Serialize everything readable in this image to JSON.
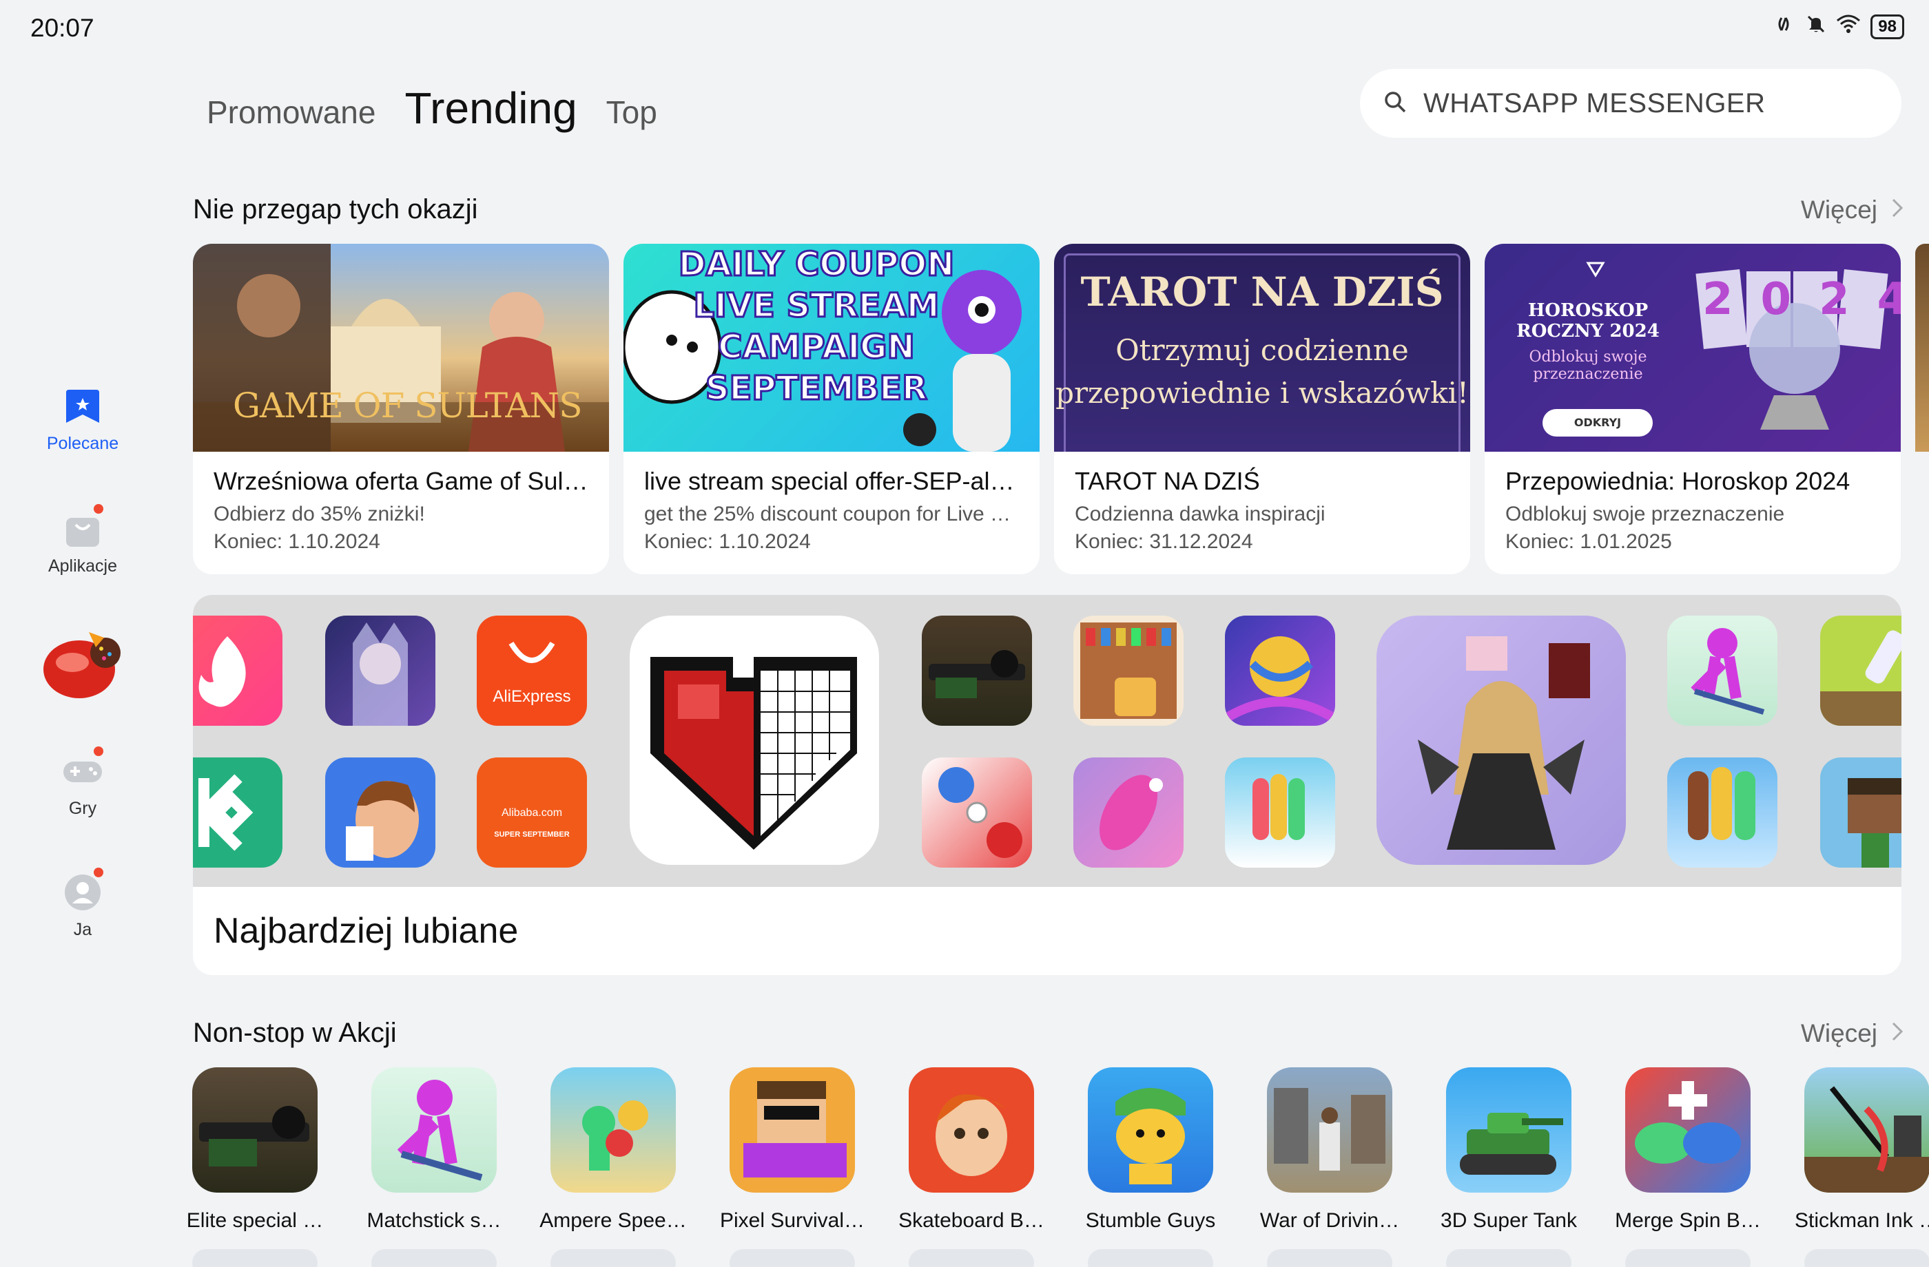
{
  "status": {
    "time": "20:07",
    "battery": "98"
  },
  "tabs": [
    {
      "label": "Promowane"
    },
    {
      "label": "Trending"
    },
    {
      "label": "Top"
    }
  ],
  "search": {
    "value": "WHATSAPP MESSENGER"
  },
  "sidebar": {
    "items": [
      {
        "label": "Polecane"
      },
      {
        "label": "Aplikacje"
      },
      {
        "label": ""
      },
      {
        "label": "Gry"
      },
      {
        "label": "Ja"
      }
    ]
  },
  "deals": {
    "title": "Nie przegap tych okazji",
    "more": "Więcej",
    "cards": [
      {
        "banner": "GAME OF SULTANS",
        "title": "Wrześniowa oferta Game of Sult…",
        "sub": "Odbierz do 35% zniżki!",
        "end": "Koniec: 1.10.2024"
      },
      {
        "banner_lines": [
          "DAILY COUPON",
          "LIVE STREAM",
          "CAMPAIGN",
          "SEPTEMBER"
        ],
        "title": "live stream special offer-SEP-al…",
        "sub": "get the 25% discount coupon for Live …",
        "end": "Koniec: 1.10.2024"
      },
      {
        "banner_title": "TAROT NA DZIŚ",
        "banner_lines": [
          "Otrzymuj codzienne",
          "przepowiednie i wskazówki!"
        ],
        "title": "TAROT NA DZIŚ",
        "sub": "Codzienna dawka inspiracji",
        "end": "Koniec: 31.12.2024"
      },
      {
        "banner_lines": [
          "HOROSKOP",
          "ROCZNY 2024",
          "Odblokuj swoje",
          "przeznaczenie"
        ],
        "banner_button": "ODKRYJ",
        "banner_year": "2024",
        "title": "Przepowiednia: Horoskop 2024",
        "sub": "Odblokuj swoje przeznaczenie",
        "end": "Koniec: 1.01.2025"
      }
    ]
  },
  "liked": {
    "title": "Najbardziej lubiane",
    "labels": {
      "aliexpress": "AliExpress",
      "alibaba": "Alibaba.com",
      "alibaba_sub": "SUPER SEPTEMBER"
    }
  },
  "nonstop": {
    "title": "Non-stop w Akcji",
    "more": "Więcej",
    "games": [
      {
        "name": "Elite special …"
      },
      {
        "name": "Matchstick s…"
      },
      {
        "name": "Ampere Spee…"
      },
      {
        "name": "Pixel Survival…"
      },
      {
        "name": "Skateboard B…"
      },
      {
        "name": "Stumble Guys"
      },
      {
        "name": "War of Drivin…"
      },
      {
        "name": "3D Super Tank"
      },
      {
        "name": "Merge Spin B…"
      },
      {
        "name": "Stickman Ink …"
      }
    ]
  },
  "colors": {
    "accent": "#1d5ff5",
    "badge": "#f04830"
  }
}
